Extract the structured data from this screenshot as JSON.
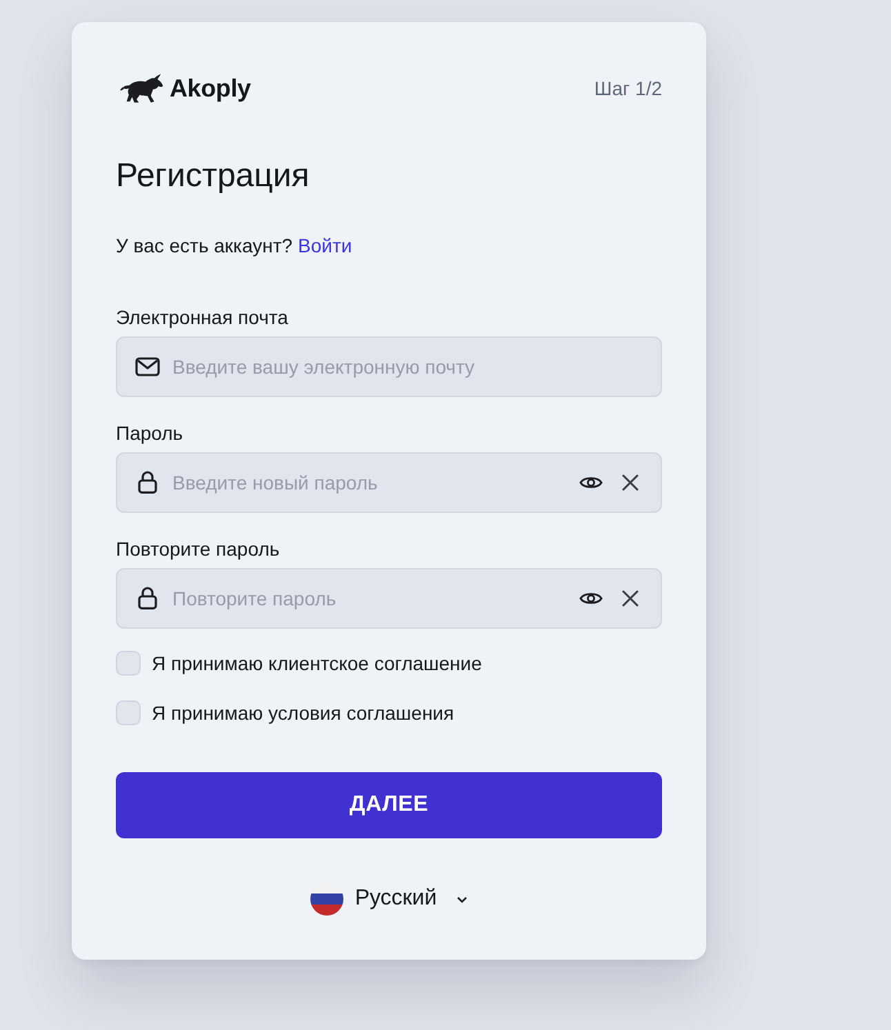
{
  "header": {
    "logo_text": "Akoply",
    "step": "Шаг 1/2"
  },
  "title": "Регистрация",
  "login_prompt": {
    "text": "У вас есть аккаунт?",
    "link": "Войти"
  },
  "fields": [
    {
      "kind": "email",
      "label": "Электронная почта",
      "placeholder": "Введите вашу электронную почту"
    },
    {
      "kind": "password",
      "label": "Пароль",
      "placeholder": "Введите новый пароль"
    },
    {
      "kind": "password",
      "label": "Повторите пароль",
      "placeholder": "Повторите пароль"
    }
  ],
  "agreements": [
    {
      "label": "Я принимаю клиентское соглашение",
      "checked": false
    },
    {
      "label": "Я принимаю условия соглашения",
      "checked": false
    }
  ],
  "submit_button": "ДАЛЕЕ",
  "language": {
    "label": "Русский"
  }
}
